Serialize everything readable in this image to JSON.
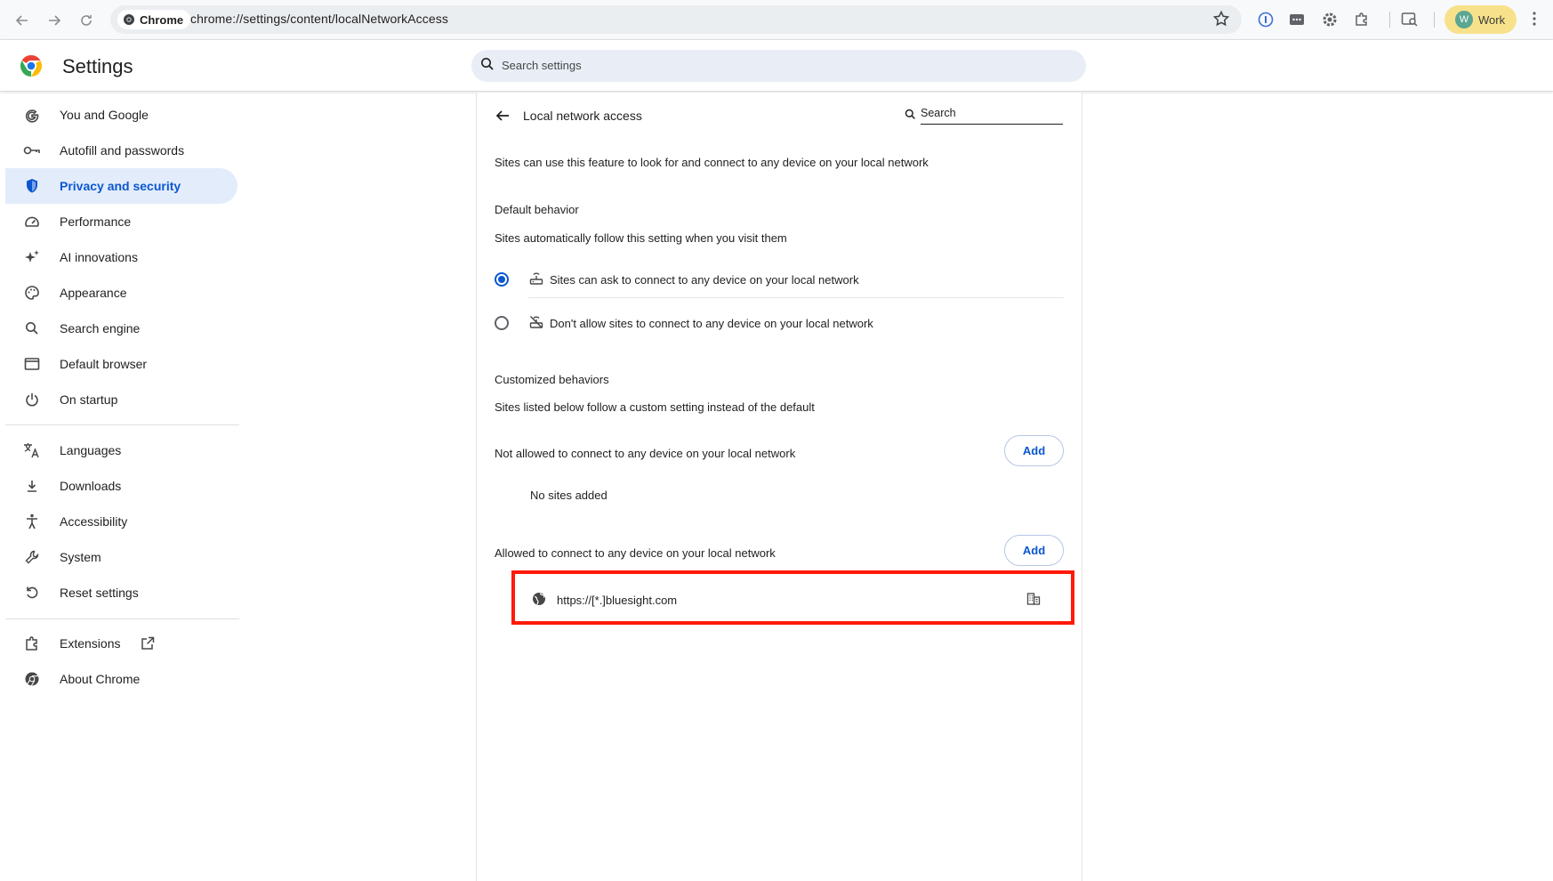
{
  "browser": {
    "site_chip_label": "Chrome",
    "url": "chrome://settings/content/localNetworkAccess",
    "profile_initial": "W",
    "profile_label": "Work"
  },
  "header": {
    "title": "Settings",
    "search_placeholder": "Search settings"
  },
  "sidebar": {
    "items": [
      {
        "label": "You and Google",
        "icon": "google-g-icon"
      },
      {
        "label": "Autofill and passwords",
        "icon": "key-icon"
      },
      {
        "label": "Privacy and security",
        "icon": "shield-icon",
        "active": true
      },
      {
        "label": "Performance",
        "icon": "speedometer-icon"
      },
      {
        "label": "AI innovations",
        "icon": "sparkle-icon"
      },
      {
        "label": "Appearance",
        "icon": "palette-icon"
      },
      {
        "label": "Search engine",
        "icon": "search-icon"
      },
      {
        "label": "Default browser",
        "icon": "browser-window-icon"
      },
      {
        "label": "On startup",
        "icon": "power-icon"
      },
      {
        "label": "Languages",
        "icon": "translate-icon"
      },
      {
        "label": "Downloads",
        "icon": "download-icon"
      },
      {
        "label": "Accessibility",
        "icon": "accessibility-icon"
      },
      {
        "label": "System",
        "icon": "wrench-icon"
      },
      {
        "label": "Reset settings",
        "icon": "reset-icon"
      },
      {
        "label": "Extensions",
        "icon": "puzzle-icon"
      },
      {
        "label": "About Chrome",
        "icon": "chrome-icon"
      }
    ]
  },
  "page": {
    "title": "Local network access",
    "search_placeholder": "Search",
    "description": "Sites can use this feature to look for and connect to any device on your local network",
    "default_behavior": {
      "heading": "Default behavior",
      "subtext": "Sites automatically follow this setting when you visit them",
      "options": [
        {
          "label": "Sites can ask to connect to any device on your local network",
          "checked": true
        },
        {
          "label": "Don't allow sites to connect to any device on your local network",
          "checked": false
        }
      ]
    },
    "customized": {
      "heading": "Customized behaviors",
      "subtext": "Sites listed below follow a custom setting instead of the default",
      "not_allowed_label": "Not allowed to connect to any device on your local network",
      "not_allowed_empty": "No sites added",
      "allowed_label": "Allowed to connect to any device on your local network",
      "add_label": "Add",
      "allowed_sites": [
        "https://[*.]bluesight.com"
      ]
    }
  },
  "colors": {
    "accent": "#0b57d0",
    "highlight_border": "#ff1a0a",
    "profile_chip": "#f7e28b"
  }
}
